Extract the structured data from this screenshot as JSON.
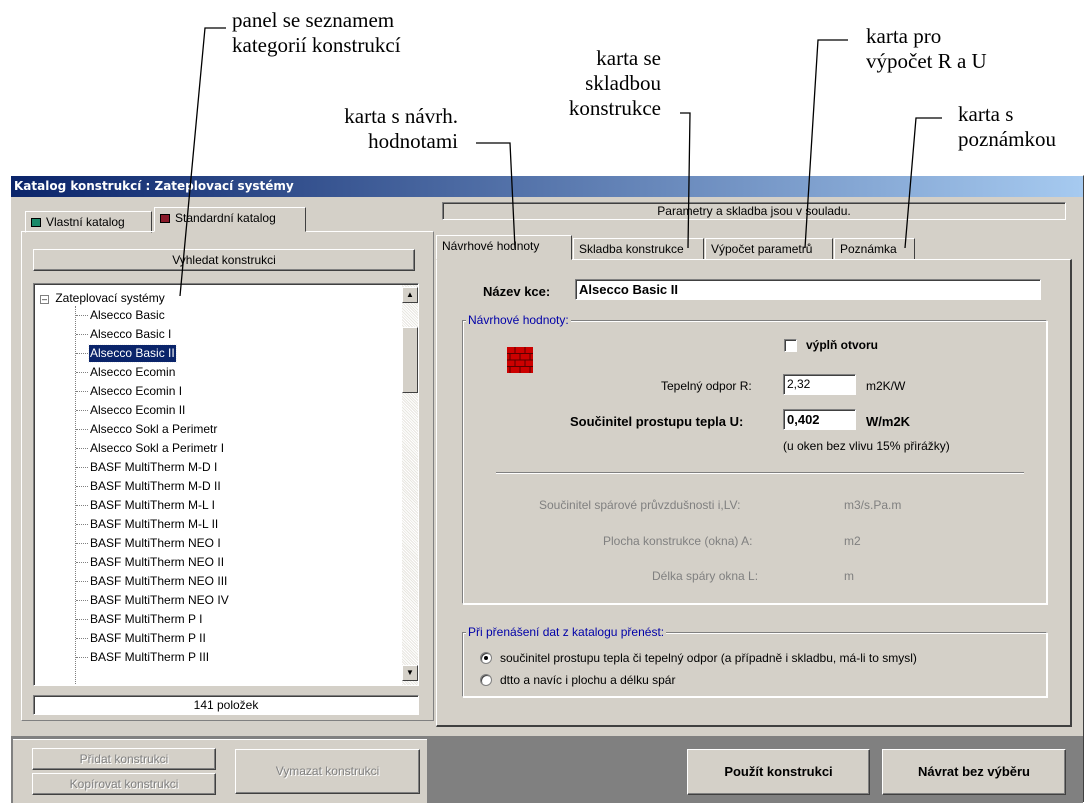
{
  "callouts": {
    "categories_panel": [
      "panel se seznamem",
      "kategorií konstrukcí"
    ],
    "composition_tab": [
      "karta se",
      "skladbou",
      "konstrukce"
    ],
    "design_values_tab": [
      "karta s návrh.",
      "hodnotami"
    ],
    "calc_tab": [
      "karta pro",
      "výpočet R a U"
    ],
    "note_tab": [
      "karta s",
      "poznámkou"
    ]
  },
  "window": {
    "title": "Katalog konstrukcí : Zateplovací systémy"
  },
  "left": {
    "tabs": [
      "Vlastní katalog",
      "Standardní katalog"
    ],
    "search_button": "Vyhledat konstrukci",
    "tree_root": "Zateplovací systémy",
    "tree_items": [
      "Alsecco Basic",
      "Alsecco Basic I",
      "Alsecco Basic II",
      "Alsecco Ecomin",
      "Alsecco Ecomin I",
      "Alsecco Ecomin II",
      "Alsecco Sokl a Perimetr",
      "Alsecco Sokl a Perimetr I",
      "BASF MultiTherm M-D I",
      "BASF MultiTherm M-D II",
      "BASF MultiTherm M-L I",
      "BASF MultiTherm M-L II",
      "BASF MultiTherm NEO I",
      "BASF MultiTherm NEO II",
      "BASF MultiTherm NEO III",
      "BASF MultiTherm NEO IV",
      "BASF MultiTherm P I",
      "BASF MultiTherm P II",
      "BASF MultiTherm P III"
    ],
    "selected_item": "Alsecco Basic II",
    "count": "141 položek"
  },
  "right": {
    "status": "Parametry a skladba jsou v souladu.",
    "tabs": [
      "Návrhové hodnoty",
      "Skladba konstrukce",
      "Výpočet parametrů",
      "Poznámka"
    ],
    "name_label": "Název kce:",
    "name_value": "Alsecco Basic II",
    "design_group": "Návrhové hodnoty:",
    "opening_fill": "výplň otvoru",
    "r_label": "Tepelný odpor  R:",
    "r_value": "2,32",
    "r_unit": "m2K/W",
    "u_label": "Součinitel prostupu tepla  U:",
    "u_value": "0,402",
    "u_unit": "W/m2K",
    "u_note": "(u oken bez vlivu 15% přirážky)",
    "iLV_label": "Součinitel spárové průvzdušnosti  i,LV:",
    "iLV_unit": "m3/s.Pa.m",
    "area_label": "Plocha konstrukce (okna)  A:",
    "area_unit": "m2",
    "joint_label": "Délka spáry okna  L:",
    "joint_unit": "m",
    "transfer_group": "Při přenášení dat z katalogu přenést:",
    "radio1": "součinitel prostupu tepla či tepelný odpor (a případně i skladbu, má-li to smysl)",
    "radio2": "dtto a navíc i plochu a délku spár"
  },
  "buttons": {
    "add": "Přidat konstrukci",
    "copy": "Kopírovat konstrukci",
    "delete": "Vymazat konstrukci",
    "use": "Použít konstrukci",
    "back": "Návrat bez výběru"
  },
  "colors": {
    "title_start": "#0a246a",
    "title_end": "#a6caf0",
    "selection": "#0a246a",
    "brick": "#cc0000",
    "group_title": "#0000a8"
  }
}
